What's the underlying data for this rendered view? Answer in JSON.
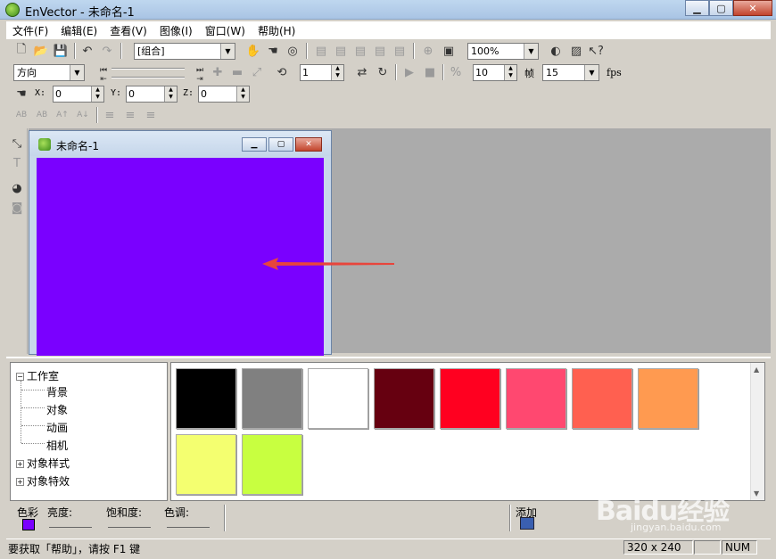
{
  "window": {
    "title": "EnVector - 未命名-1"
  },
  "menu": [
    "文件(F)",
    "编辑(E)",
    "查看(V)",
    "图像(I)",
    "窗口(W)",
    "帮助(H)"
  ],
  "toolbar1": {
    "group_select": "[组合]",
    "zoom": "100%"
  },
  "toolbar2": {
    "direction": "方向",
    "frame_value": "1",
    "fps_value": "10",
    "frame_label": "帧",
    "fps_select": "15",
    "fps_label": "fps"
  },
  "toolbar3": {
    "x_label": "X:",
    "x_value": "0",
    "y_label": "Y:",
    "y_value": "0",
    "z_label": "Z:",
    "z_value": "0"
  },
  "document": {
    "title": "未命名-1",
    "canvas_color": "#7a00ff"
  },
  "tree": {
    "root": "工作室",
    "children": [
      "背景",
      "对象",
      "动画",
      "相机"
    ],
    "others": [
      "对象样式",
      "对象特效"
    ]
  },
  "swatches": [
    "#000000",
    "#808080",
    "#ffffff",
    "#660010",
    "#ff0020",
    "#ff4870",
    "#ff6050",
    "#ff9a50",
    "#f4ff70",
    "#c8ff40"
  ],
  "colorbar": {
    "color_label": "色彩",
    "brightness_label": "亮度:",
    "saturation_label": "饱和度:",
    "hue_label": "色调:",
    "add_label": "添加"
  },
  "status": {
    "help_text": "要获取「帮助」，请按 F1 键",
    "size": "320 x 240",
    "num": "NUM"
  },
  "watermark": {
    "text": "Baidu经验",
    "url": "jingyan.baidu.com"
  }
}
